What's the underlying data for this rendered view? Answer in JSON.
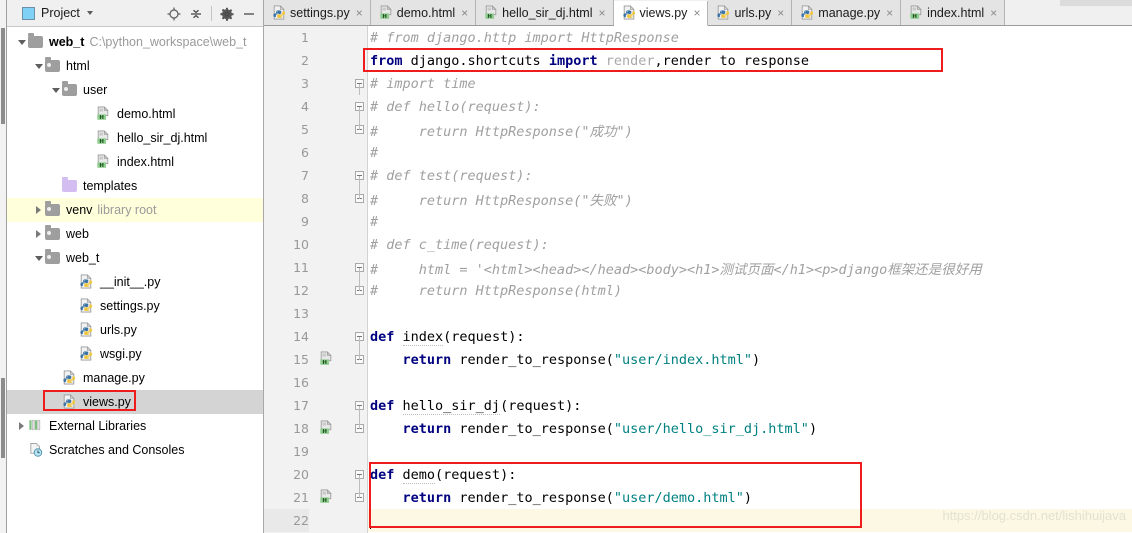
{
  "project_panel": {
    "title": "Project",
    "icons": {
      "project_icon": "project-window-icon",
      "locate_icon": "locate-target-icon",
      "collapse_icon": "collapse-all-icon",
      "settings_icon": "gear-icon",
      "hide_icon": "minimize-icon"
    },
    "tree": [
      {
        "label": "web_t",
        "hint": "C:\\python_workspace\\web_t",
        "icon": "folder-module-icon",
        "indent": 0,
        "expander": "down",
        "bold": true,
        "state": "normal"
      },
      {
        "label": "html",
        "hint": "",
        "icon": "folder-icon",
        "indent": 1,
        "expander": "down",
        "bold": false,
        "state": "normal"
      },
      {
        "label": "user",
        "hint": "",
        "icon": "folder-icon",
        "indent": 2,
        "expander": "down",
        "bold": false,
        "state": "normal"
      },
      {
        "label": "demo.html",
        "hint": "",
        "icon": "html-file-icon",
        "indent": 4,
        "expander": "none",
        "bold": false,
        "state": "normal"
      },
      {
        "label": "hello_sir_dj.html",
        "hint": "",
        "icon": "html-file-icon",
        "indent": 4,
        "expander": "none",
        "bold": false,
        "state": "normal"
      },
      {
        "label": "index.html",
        "hint": "",
        "icon": "html-file-icon",
        "indent": 4,
        "expander": "none",
        "bold": false,
        "state": "normal"
      },
      {
        "label": "templates",
        "hint": "",
        "icon": "folder-templates-icon",
        "indent": 2,
        "expander": "none",
        "bold": false,
        "state": "normal"
      },
      {
        "label": "venv",
        "hint": "library root",
        "icon": "folder-icon",
        "indent": 1,
        "expander": "right",
        "bold": false,
        "state": "highlighted"
      },
      {
        "label": "web",
        "hint": "",
        "icon": "folder-icon",
        "indent": 1,
        "expander": "right",
        "bold": false,
        "state": "normal"
      },
      {
        "label": "web_t",
        "hint": "",
        "icon": "folder-icon",
        "indent": 1,
        "expander": "down",
        "bold": false,
        "state": "normal"
      },
      {
        "label": "__init__.py",
        "hint": "",
        "icon": "python-file-icon",
        "indent": 3,
        "expander": "none",
        "bold": false,
        "state": "normal"
      },
      {
        "label": "settings.py",
        "hint": "",
        "icon": "python-file-icon",
        "indent": 3,
        "expander": "none",
        "bold": false,
        "state": "normal"
      },
      {
        "label": "urls.py",
        "hint": "",
        "icon": "python-file-icon",
        "indent": 3,
        "expander": "none",
        "bold": false,
        "state": "normal"
      },
      {
        "label": "wsgi.py",
        "hint": "",
        "icon": "python-file-icon",
        "indent": 3,
        "expander": "none",
        "bold": false,
        "state": "normal"
      },
      {
        "label": "manage.py",
        "hint": "",
        "icon": "python-file-icon",
        "indent": 2,
        "expander": "none",
        "bold": false,
        "state": "normal"
      },
      {
        "label": "views.py",
        "hint": "",
        "icon": "python-file-icon",
        "indent": 2,
        "expander": "none",
        "bold": false,
        "state": "selected"
      },
      {
        "label": "External Libraries",
        "hint": "",
        "icon": "libraries-icon",
        "indent": 0,
        "expander": "right",
        "bold": false,
        "state": "normal"
      },
      {
        "label": "Scratches and Consoles",
        "hint": "",
        "icon": "scratches-icon",
        "indent": 0,
        "expander": "none",
        "bold": false,
        "state": "normal"
      }
    ]
  },
  "editor": {
    "tabs": [
      {
        "label": "settings.py",
        "icon": "python-file-icon",
        "active": false
      },
      {
        "label": "demo.html",
        "icon": "html-file-icon",
        "active": false
      },
      {
        "label": "hello_sir_dj.html",
        "icon": "html-file-icon",
        "active": false
      },
      {
        "label": "views.py",
        "icon": "python-file-icon",
        "active": true
      },
      {
        "label": "urls.py",
        "icon": "python-file-icon",
        "active": false
      },
      {
        "label": "manage.py",
        "icon": "python-file-icon",
        "active": false
      },
      {
        "label": "index.html",
        "icon": "html-file-icon",
        "active": false
      }
    ],
    "close_glyph": "×",
    "lines": [
      {
        "num": "1",
        "gutter_icon": "",
        "fold": "none",
        "current": false,
        "tokens": [
          {
            "t": "# from django.http import HttpResponse",
            "c": "cmt"
          }
        ]
      },
      {
        "num": "2",
        "gutter_icon": "",
        "fold": "none",
        "current": false,
        "tokens": [
          {
            "t": "from",
            "c": "kw"
          },
          {
            "t": " django.shortcuts ",
            "c": "plain2"
          },
          {
            "t": "import",
            "c": "kw"
          },
          {
            "t": " ",
            "c": "plain2"
          },
          {
            "t": "render",
            "c": "grey"
          },
          {
            "t": ",render to response",
            "c": "plain2"
          }
        ]
      },
      {
        "num": "3",
        "gutter_icon": "",
        "fold": "collapsed",
        "current": false,
        "tokens": [
          {
            "t": "# import time",
            "c": "cmt"
          }
        ]
      },
      {
        "num": "4",
        "gutter_icon": "",
        "fold": "collapsed",
        "current": false,
        "tokens": [
          {
            "t": "# def hello(request):",
            "c": "cmt"
          }
        ]
      },
      {
        "num": "5",
        "gutter_icon": "",
        "fold": "end",
        "current": false,
        "tokens": [
          {
            "t": "#     return HttpResponse(\"成功\")",
            "c": "cmt"
          }
        ]
      },
      {
        "num": "6",
        "gutter_icon": "",
        "fold": "none",
        "current": false,
        "tokens": [
          {
            "t": "#",
            "c": "cmt"
          }
        ]
      },
      {
        "num": "7",
        "gutter_icon": "",
        "fold": "collapsed",
        "current": false,
        "tokens": [
          {
            "t": "# def test(request):",
            "c": "cmt"
          }
        ]
      },
      {
        "num": "8",
        "gutter_icon": "",
        "fold": "end",
        "current": false,
        "tokens": [
          {
            "t": "#     return HttpResponse(\"失败\")",
            "c": "cmt"
          }
        ]
      },
      {
        "num": "9",
        "gutter_icon": "",
        "fold": "none",
        "current": false,
        "tokens": [
          {
            "t": "#",
            "c": "cmt"
          }
        ]
      },
      {
        "num": "10",
        "gutter_icon": "",
        "fold": "none",
        "current": false,
        "tokens": [
          {
            "t": "# def c_time(request):",
            "c": "cmt"
          }
        ]
      },
      {
        "num": "11",
        "gutter_icon": "",
        "fold": "collapsed",
        "current": false,
        "tokens": [
          {
            "t": "#     html = '<html><head></head><body><h1>测试页面</h1><p>django框架还是很好用",
            "c": "cmt"
          }
        ]
      },
      {
        "num": "12",
        "gutter_icon": "",
        "fold": "end",
        "current": false,
        "tokens": [
          {
            "t": "#     return HttpResponse(html)",
            "c": "cmt"
          }
        ]
      },
      {
        "num": "13",
        "gutter_icon": "",
        "fold": "none",
        "current": false,
        "tokens": []
      },
      {
        "num": "14",
        "gutter_icon": "",
        "fold": "collapsed",
        "current": false,
        "tokens": [
          {
            "t": "def",
            "c": "kw"
          },
          {
            "t": " ",
            "c": "plain2"
          },
          {
            "t": "index",
            "c": "fname"
          },
          {
            "t": "(request):",
            "c": "plain2"
          }
        ]
      },
      {
        "num": "15",
        "gutter_icon": "html-file-icon",
        "fold": "end",
        "current": false,
        "tokens": [
          {
            "t": "    ",
            "c": "plain2"
          },
          {
            "t": "return",
            "c": "kw"
          },
          {
            "t": " render_to_response(",
            "c": "plain2"
          },
          {
            "t": "\"user/index.html\"",
            "c": "str"
          },
          {
            "t": ")",
            "c": "plain2"
          }
        ]
      },
      {
        "num": "16",
        "gutter_icon": "",
        "fold": "none",
        "current": false,
        "tokens": []
      },
      {
        "num": "17",
        "gutter_icon": "",
        "fold": "collapsed",
        "current": false,
        "tokens": [
          {
            "t": "def",
            "c": "kw"
          },
          {
            "t": " ",
            "c": "plain2"
          },
          {
            "t": "hello_sir_dj",
            "c": "fname"
          },
          {
            "t": "(request):",
            "c": "plain2"
          }
        ]
      },
      {
        "num": "18",
        "gutter_icon": "html-file-icon",
        "fold": "end",
        "current": false,
        "tokens": [
          {
            "t": "    ",
            "c": "plain2"
          },
          {
            "t": "return",
            "c": "kw"
          },
          {
            "t": " render_to_response(",
            "c": "plain2"
          },
          {
            "t": "\"user/hello_sir_dj.html\"",
            "c": "str"
          },
          {
            "t": ")",
            "c": "plain2"
          }
        ]
      },
      {
        "num": "19",
        "gutter_icon": "",
        "fold": "none",
        "current": false,
        "tokens": []
      },
      {
        "num": "20",
        "gutter_icon": "",
        "fold": "collapsed",
        "current": false,
        "tokens": [
          {
            "t": "def",
            "c": "kw"
          },
          {
            "t": " ",
            "c": "plain2"
          },
          {
            "t": "demo",
            "c": "fname"
          },
          {
            "t": "(request):",
            "c": "plain2"
          }
        ]
      },
      {
        "num": "21",
        "gutter_icon": "html-file-icon",
        "fold": "end",
        "current": false,
        "tokens": [
          {
            "t": "    ",
            "c": "plain2"
          },
          {
            "t": "return",
            "c": "kw"
          },
          {
            "t": " render_to_response(",
            "c": "plain2"
          },
          {
            "t": "\"user/demo.html\"",
            "c": "str"
          },
          {
            "t": ")",
            "c": "plain2"
          }
        ]
      },
      {
        "num": "22",
        "gutter_icon": "",
        "fold": "none",
        "current": true,
        "tokens": []
      }
    ]
  },
  "annotations": {
    "highlight_color": "#ee1c1c",
    "boxes": [
      {
        "name": "import-line-highlight"
      },
      {
        "name": "demo-function-highlight"
      },
      {
        "name": "views-py-tree-highlight"
      }
    ]
  },
  "watermark": "https://blog.csdn.net/lishihuijava"
}
